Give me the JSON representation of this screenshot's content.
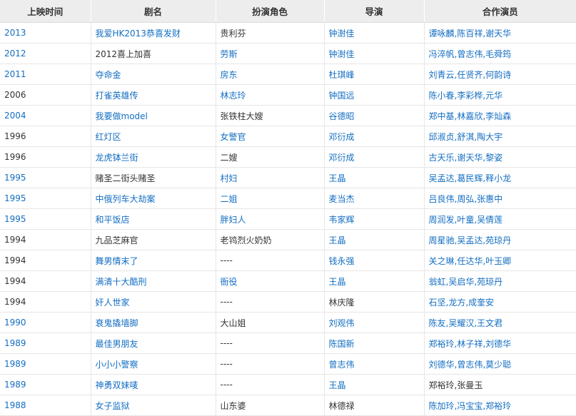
{
  "table": {
    "headers": [
      "上映时间",
      "剧名",
      "扮演角色",
      "导演",
      "合作演员"
    ],
    "rows": [
      {
        "year": "2013",
        "year_link": true,
        "title": "我爱HK2013恭喜发财",
        "title_link": true,
        "role": "贵利芬",
        "role_link": false,
        "director": "钟澍佳",
        "director_link": true,
        "costars": "谭咏麟,陈百祥,谢天华",
        "costars_link": true
      },
      {
        "year": "2012",
        "year_link": true,
        "title": "2012喜上加喜",
        "title_link": false,
        "role": "劳斯",
        "role_link": true,
        "director": "钟澍佳",
        "director_link": true,
        "costars": "冯淬帆,曾志伟,毛舜筠",
        "costars_link": true
      },
      {
        "year": "2011",
        "year_link": true,
        "title": "夺命金",
        "title_link": true,
        "role": "房东",
        "role_link": true,
        "director": "杜琪峰",
        "director_link": true,
        "costars": "刘青云,任贤齐,何韵诗",
        "costars_link": true
      },
      {
        "year": "2006",
        "year_link": false,
        "title": "打雀英雄传",
        "title_link": true,
        "role": "林志玲",
        "role_link": true,
        "director": "钟国远",
        "director_link": true,
        "costars": "陈小春,李彩桦,元华",
        "costars_link": true
      },
      {
        "year": "2004",
        "year_link": true,
        "title": "我要做model",
        "title_link": true,
        "role": "张铁柱大嫂",
        "role_link": false,
        "director": "谷德昭",
        "director_link": true,
        "costars": "郑中基,林嘉欣,李灿森",
        "costars_link": true
      },
      {
        "year": "1996",
        "year_link": false,
        "title": "红灯区",
        "title_link": true,
        "role": "女警官",
        "role_link": true,
        "director": "邓衍成",
        "director_link": true,
        "costars": "邱淑贞,舒淇,陶大宇",
        "costars_link": true
      },
      {
        "year": "1996",
        "year_link": false,
        "title": "龙虎钵兰街",
        "title_link": true,
        "role": "二嫂",
        "role_link": false,
        "director": "邓衍成",
        "director_link": true,
        "costars": "古天乐,谢天华,黎姿",
        "costars_link": true
      },
      {
        "year": "1995",
        "year_link": true,
        "title": "赌圣二街头赌圣",
        "title_link": false,
        "role": "村妇",
        "role_link": true,
        "director": "王晶",
        "director_link": true,
        "costars": "吴孟达,葛民辉,释小龙",
        "costars_link": true
      },
      {
        "year": "1995",
        "year_link": true,
        "title": "中俄列车大劫案",
        "title_link": true,
        "role": "二姐",
        "role_link": true,
        "director": "麦当杰",
        "director_link": true,
        "costars": "吕良伟,周弘,张惠中",
        "costars_link": true
      },
      {
        "year": "1995",
        "year_link": true,
        "title": "和平饭店",
        "title_link": true,
        "role": "胖妇人",
        "role_link": true,
        "director": "韦家辉",
        "director_link": true,
        "costars": "周润发,叶童,吴倩莲",
        "costars_link": true
      },
      {
        "year": "1994",
        "year_link": false,
        "title": "九品芝麻官",
        "title_link": false,
        "role": "老鸨烈火奶奶",
        "role_link": false,
        "director": "王晶",
        "director_link": true,
        "costars": "周星驰,吴孟达,苑琼丹",
        "costars_link": true
      },
      {
        "year": "1994",
        "year_link": false,
        "title": "舞男情末了",
        "title_link": true,
        "role": "----",
        "role_link": false,
        "director": "钱永强",
        "director_link": true,
        "costars": "关之琳,任达华,叶玉卿",
        "costars_link": true
      },
      {
        "year": "1994",
        "year_link": false,
        "title": "满清十大酷刑",
        "title_link": true,
        "role": "衙役",
        "role_link": true,
        "director": "王晶",
        "director_link": true,
        "costars": "翁虹,吴启华,苑琼丹",
        "costars_link": true
      },
      {
        "year": "1994",
        "year_link": false,
        "title": "奸人世家",
        "title_link": true,
        "role": "----",
        "role_link": false,
        "director": "林庆隆",
        "director_link": false,
        "costars": "石坚,龙方,成奎安",
        "costars_link": true
      },
      {
        "year": "1990",
        "year_link": true,
        "title": "衰鬼撬墙脚",
        "title_link": true,
        "role": "大山姐",
        "role_link": false,
        "director": "刘观伟",
        "director_link": true,
        "costars": "陈友,吴耀汉,王文君",
        "costars_link": true
      },
      {
        "year": "1989",
        "year_link": true,
        "title": "最佳男朋友",
        "title_link": true,
        "role": "----",
        "role_link": false,
        "director": "陈国新",
        "director_link": true,
        "costars": "郑裕玲,林子祥,刘德华",
        "costars_link": true
      },
      {
        "year": "1989",
        "year_link": true,
        "title": "小小小警察",
        "title_link": true,
        "role": "----",
        "role_link": false,
        "director": "曾志伟",
        "director_link": true,
        "costars": "刘德华,曾志伟,莫少聪",
        "costars_link": true
      },
      {
        "year": "1989",
        "year_link": true,
        "title": "神勇双妹唛",
        "title_link": true,
        "role": "----",
        "role_link": false,
        "director": "王晶",
        "director_link": true,
        "costars": "郑裕玲,张曼玉",
        "costars_link": false
      },
      {
        "year": "1988",
        "year_link": true,
        "title": "女子监狱",
        "title_link": true,
        "role": "山东婆",
        "role_link": false,
        "director": "林德禄",
        "director_link": false,
        "costars": "陈加玲,冯宝宝,郑裕玲",
        "costars_link": true
      }
    ]
  },
  "colors": {
    "link": "#136ec2",
    "text": "#333333",
    "header_bg": "#ededed",
    "grid": "#e6e6e6"
  }
}
